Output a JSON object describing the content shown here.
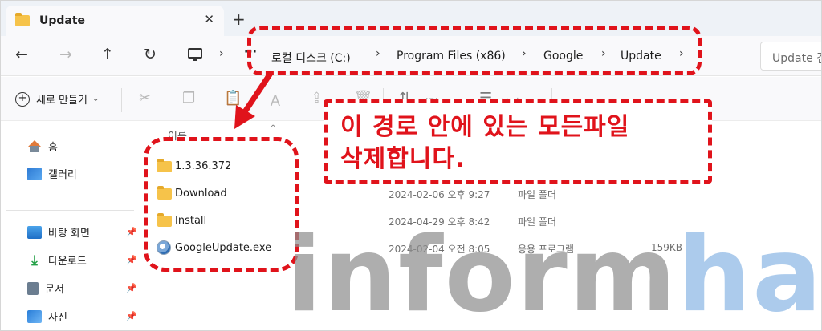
{
  "window": {
    "tab_title": "Update",
    "tab_close": "✕",
    "new_tab": "+"
  },
  "nav": {
    "back": "←",
    "forward": "→",
    "up": "↑",
    "refresh": "↻",
    "more": "···",
    "breadcrumb": [
      "로컬 디스크 (C:)",
      "Program Files (x86)",
      "Google",
      "Update"
    ],
    "search_placeholder": "Update 검색"
  },
  "toolbar": {
    "new_label": "새로 만들기",
    "sort_label": "정렬",
    "view_label": "보기"
  },
  "sidebar": {
    "items": [
      {
        "label": "홈",
        "icon": "home-icon",
        "pinned": false
      },
      {
        "label": "갤러리",
        "icon": "gallery-icon",
        "pinned": false
      },
      {
        "label": "바탕 화면",
        "icon": "desktop-icon",
        "pinned": true
      },
      {
        "label": "다운로드",
        "icon": "download-icon",
        "pinned": true
      },
      {
        "label": "문서",
        "icon": "document-icon",
        "pinned": true
      },
      {
        "label": "사진",
        "icon": "pictures-icon",
        "pinned": true
      }
    ]
  },
  "list": {
    "column_name": "이름",
    "rows": [
      {
        "name": "1.3.36.372",
        "date": "",
        "type": "",
        "size": "",
        "icon": "folder-icon"
      },
      {
        "name": "Download",
        "date": "2024-02-06 오후 9:27",
        "type": "파일 폴더",
        "size": "",
        "icon": "folder-icon"
      },
      {
        "name": "Install",
        "date": "2024-04-29 오후 8:42",
        "type": "파일 폴더",
        "size": "",
        "icon": "folder-icon"
      },
      {
        "name": "GoogleUpdate.exe",
        "date": "2024-02-04 오전 8:05",
        "type": "응용 프로그램",
        "size": "159KB",
        "icon": "application-icon"
      }
    ]
  },
  "annotation": {
    "line1": "이 경로 안에 있는 모든파일",
    "line2": "삭제합니다.",
    "color": "#e0131b"
  },
  "watermark": {
    "part1": "inform",
    "part2": "hack"
  }
}
